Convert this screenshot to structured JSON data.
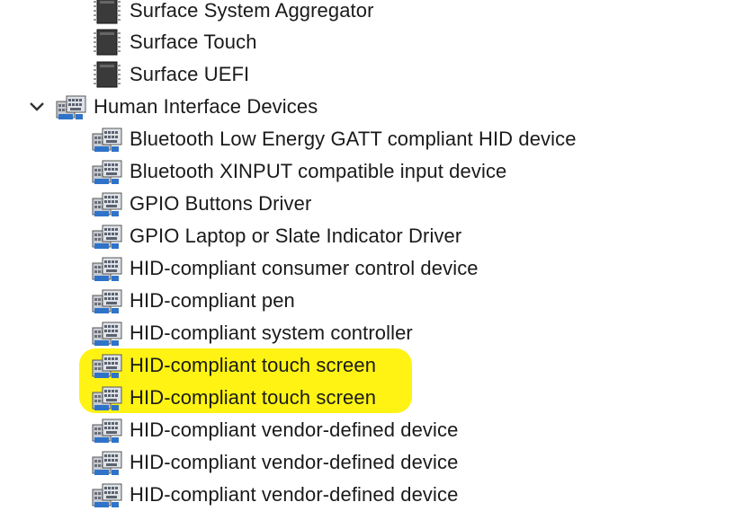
{
  "tree": {
    "system_children": [
      {
        "label": "Surface System Aggregator",
        "icon": "chip-icon"
      },
      {
        "label": "Surface Touch",
        "icon": "chip-icon"
      },
      {
        "label": "Surface UEFI",
        "icon": "chip-icon"
      }
    ],
    "category": {
      "label": "Human Interface Devices",
      "expanded": true,
      "icon": "hid-category-icon",
      "chevron": "chevron-down-icon"
    },
    "hid_children": [
      {
        "label": "Bluetooth Low Energy GATT compliant HID device",
        "icon": "hid-device-icon",
        "highlighted": false
      },
      {
        "label": "Bluetooth XINPUT compatible input device",
        "icon": "hid-device-icon",
        "highlighted": false
      },
      {
        "label": "GPIO Buttons Driver",
        "icon": "hid-device-icon",
        "highlighted": false
      },
      {
        "label": "GPIO Laptop or Slate Indicator Driver",
        "icon": "hid-device-icon",
        "highlighted": false
      },
      {
        "label": "HID-compliant consumer control device",
        "icon": "hid-device-icon",
        "highlighted": false
      },
      {
        "label": "HID-compliant pen",
        "icon": "hid-device-icon",
        "highlighted": false
      },
      {
        "label": "HID-compliant system controller",
        "icon": "hid-device-icon",
        "highlighted": false
      },
      {
        "label": "HID-compliant touch screen",
        "icon": "hid-device-icon",
        "highlighted": true
      },
      {
        "label": "HID-compliant touch screen",
        "icon": "hid-device-icon",
        "highlighted": true
      },
      {
        "label": "HID-compliant vendor-defined device",
        "icon": "hid-device-icon",
        "highlighted": false
      },
      {
        "label": "HID-compliant vendor-defined device",
        "icon": "hid-device-icon",
        "highlighted": false
      },
      {
        "label": "HID-compliant vendor-defined device",
        "icon": "hid-device-icon",
        "highlighted": false
      }
    ]
  },
  "colors": {
    "highlight": "#fff200",
    "text": "#1a1a1a",
    "background": "#ffffff"
  }
}
